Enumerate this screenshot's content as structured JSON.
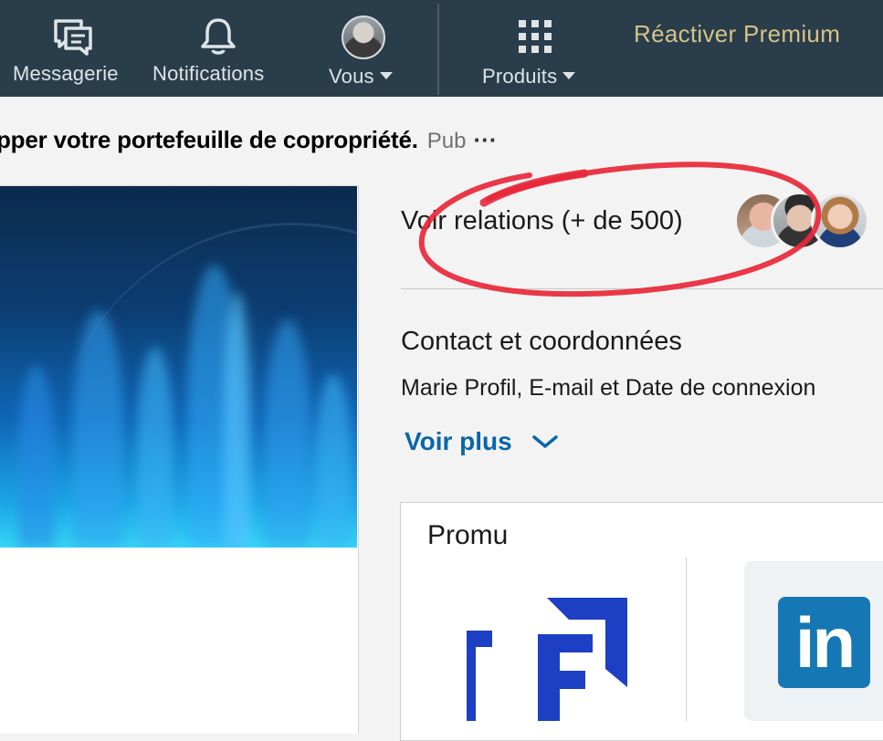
{
  "nav": {
    "messaging_label": "Messagerie",
    "notifications_label": "Notifications",
    "me_label": "Vous",
    "products_label": "Produits",
    "premium_label": "Réactiver Premium"
  },
  "ad": {
    "text": "pper votre portefeuille de copropriété.",
    "badge": "Pub",
    "more": "···"
  },
  "profile": {
    "connections_label": "Voir relations (+ de 500)",
    "contact_title": "Contact et coordonnées",
    "contact_subtitle": "Marie Profil, E-mail et Date de connexion",
    "see_more_label": "Voir plus",
    "see_more_icon": "chevron-down-icon"
  },
  "promo": {
    "title": "Promu",
    "ad1_logo_text": "FE",
    "ad2_logo_text": "in"
  },
  "colors": {
    "navbar": "#293e4a",
    "premium": "#d6c28a",
    "link": "#0a66a8",
    "annotation": "#e8283a",
    "linkedin": "#1677b5"
  }
}
